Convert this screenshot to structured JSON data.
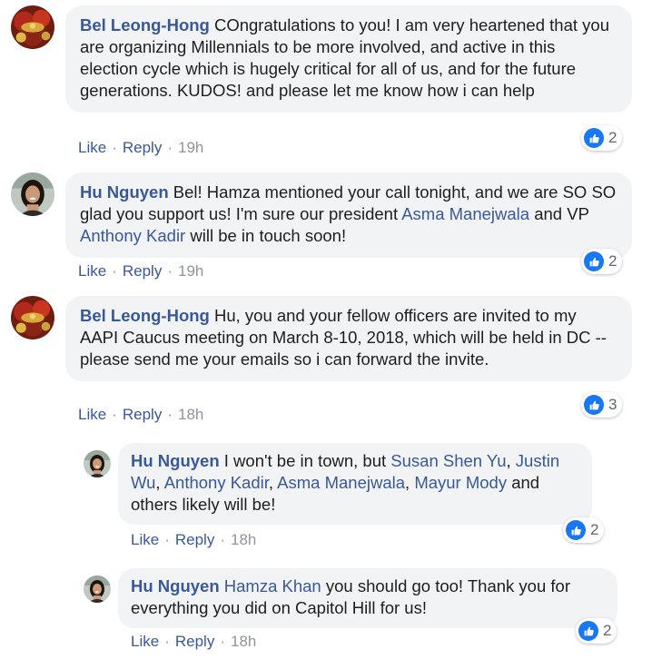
{
  "labels": {
    "like": "Like",
    "reply": "Reply",
    "separator": "·"
  },
  "comments": [
    {
      "author": "Bel Leong-Hong",
      "body": " COngratulations to you! I am very heartened that you are organizing Millennials to be more involved, and active in this election cycle which is hugely critical for all of us, and for the future generations. KUDOS! and please let me know how i can help",
      "time": "19h",
      "reactions": "2"
    },
    {
      "author": "Hu Nguyen",
      "segments": [
        {
          "text": " Bel! Hamza mentioned your call tonight, and we are SO SO glad you support us! I'm sure our president "
        },
        {
          "tag": "Asma Manejwala"
        },
        {
          "text": " and VP "
        },
        {
          "tag": "Anthony Kadir"
        },
        {
          "text": " will be in touch soon!"
        }
      ],
      "time": "19h",
      "reactions": "2"
    },
    {
      "author": "Bel Leong-Hong",
      "body": " Hu, you and your fellow officers are invited to my AAPI Caucus meeting on March 8-10, 2018, which will be held in DC -- please send me your emails so i can forward the invite.",
      "time": "18h",
      "reactions": "3"
    },
    {
      "author": "Hu Nguyen",
      "segments": [
        {
          "text": " I won't be in town, but "
        },
        {
          "tag": "Susan Shen Yu"
        },
        {
          "text": ", "
        },
        {
          "tag": "Justin Wu"
        },
        {
          "text": ", "
        },
        {
          "tag": "Anthony Kadir"
        },
        {
          "text": ", "
        },
        {
          "tag": "Asma Manejwala"
        },
        {
          "text": ", "
        },
        {
          "tag": "Mayur Mody"
        },
        {
          "text": " and others likely will be!"
        }
      ],
      "time": "18h",
      "reactions": "2"
    },
    {
      "author": "Hu Nguyen",
      "segments": [
        {
          "text": " "
        },
        {
          "tag": "Hamza Khan"
        },
        {
          "text": " you should go too! Thank you for everything you did on Capitol Hill for us!"
        }
      ],
      "time": "18h",
      "reactions": "2"
    }
  ],
  "colors": {
    "link": "#385898",
    "bubble": "#f2f3f5",
    "like_blue": "#1877f2",
    "meta": "#90949c"
  },
  "icons": {
    "reaction": "thumbs-up-icon"
  }
}
